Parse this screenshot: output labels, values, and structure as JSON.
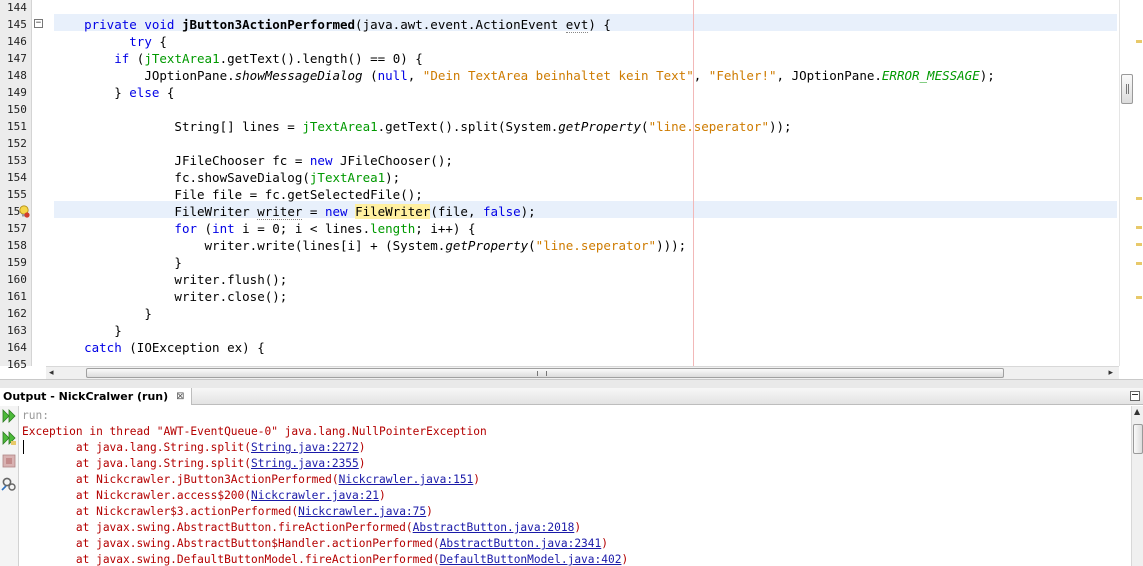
{
  "editor": {
    "line_numbers": [
      "144",
      "145",
      "146",
      "147",
      "148",
      "149",
      "150",
      "151",
      "152",
      "153",
      "154",
      "155",
      "156",
      "157",
      "158",
      "159",
      "160",
      "161",
      "162",
      "163",
      "164",
      "165"
    ],
    "lines": [
      {
        "n": 0,
        "indent": "",
        "parts": []
      },
      {
        "n": 1,
        "indent": "    ",
        "parts": [
          [
            "kw",
            "private void "
          ],
          [
            "bold",
            "jButton3ActionPerformed"
          ],
          [
            "",
            "(java.awt.event.ActionEvent "
          ],
          [
            "dotted",
            "evt"
          ],
          [
            "",
            ") {"
          ]
        ]
      },
      {
        "n": 2,
        "indent": "          ",
        "parts": [
          [
            "kw",
            "try"
          ],
          [
            "",
            " {"
          ]
        ]
      },
      {
        "n": 3,
        "indent": "        ",
        "parts": [
          [
            "kw",
            "if"
          ],
          [
            "",
            " ("
          ],
          [
            "fld",
            "jTextArea1"
          ],
          [
            "",
            ".getText().length() == 0) {"
          ]
        ]
      },
      {
        "n": 4,
        "indent": "            ",
        "parts": [
          [
            "",
            "JOptionPane."
          ],
          [
            "it",
            "showMessageDialog"
          ],
          [
            "",
            " ("
          ],
          [
            "kw",
            "null"
          ],
          [
            "",
            ", "
          ],
          [
            "str",
            "\"Dein TextArea beinhaltet kein Text\""
          ],
          [
            "",
            ", "
          ],
          [
            "str",
            "\"Fehler!\""
          ],
          [
            "",
            ", JOptionPane."
          ],
          [
            "fld it",
            "ERROR_MESSAGE"
          ],
          [
            "",
            ");"
          ]
        ]
      },
      {
        "n": 5,
        "indent": "        ",
        "parts": [
          [
            "",
            "} "
          ],
          [
            "kw",
            "else"
          ],
          [
            "",
            " {"
          ]
        ]
      },
      {
        "n": 6,
        "indent": "",
        "parts": []
      },
      {
        "n": 7,
        "indent": "                ",
        "parts": [
          [
            "",
            "String[] lines = "
          ],
          [
            "fld",
            "jTextArea1"
          ],
          [
            "",
            ".getText().split(System."
          ],
          [
            "it",
            "getProperty"
          ],
          [
            "",
            "("
          ],
          [
            "str",
            "\"line.seperator\""
          ],
          [
            "",
            "));"
          ]
        ]
      },
      {
        "n": 8,
        "indent": "",
        "parts": []
      },
      {
        "n": 9,
        "indent": "                ",
        "parts": [
          [
            "",
            "JFileChooser fc = "
          ],
          [
            "kw",
            "new"
          ],
          [
            "",
            " JFileChooser();"
          ]
        ]
      },
      {
        "n": 10,
        "indent": "                ",
        "parts": [
          [
            "",
            "fc.showSaveDialog("
          ],
          [
            "fld",
            "jTextArea1"
          ],
          [
            "",
            ");"
          ]
        ]
      },
      {
        "n": 11,
        "indent": "                ",
        "parts": [
          [
            "",
            "File file = fc.getSelectedFile();"
          ]
        ]
      },
      {
        "n": 12,
        "indent": "                ",
        "parts": [
          [
            "",
            "FileWriter "
          ],
          [
            "dotted",
            "writer"
          ],
          [
            "",
            " = "
          ],
          [
            "kw",
            "new "
          ],
          [
            "mark",
            "FileWriter"
          ],
          [
            "",
            "(file, "
          ],
          [
            "kw",
            "false"
          ],
          [
            "",
            ");"
          ]
        ]
      },
      {
        "n": 13,
        "indent": "                ",
        "parts": [
          [
            "kw",
            "for"
          ],
          [
            "",
            " ("
          ],
          [
            "kw",
            "int"
          ],
          [
            "",
            " i = 0; i < lines."
          ],
          [
            "fld",
            "length"
          ],
          [
            "",
            "; i++) {"
          ]
        ]
      },
      {
        "n": 14,
        "indent": "                    ",
        "parts": [
          [
            "",
            "writer.write(lines[i] + (System."
          ],
          [
            "it",
            "getProperty"
          ],
          [
            "",
            "("
          ],
          [
            "str",
            "\"line.seperator\""
          ],
          [
            "",
            ")));"
          ]
        ]
      },
      {
        "n": 15,
        "indent": "                ",
        "parts": [
          [
            "",
            "}"
          ]
        ]
      },
      {
        "n": 16,
        "indent": "                ",
        "parts": [
          [
            "",
            "writer.flush();"
          ]
        ]
      },
      {
        "n": 17,
        "indent": "                ",
        "parts": [
          [
            "",
            "writer.close();"
          ]
        ]
      },
      {
        "n": 18,
        "indent": "            ",
        "parts": [
          [
            "",
            "}"
          ]
        ]
      },
      {
        "n": 19,
        "indent": "        ",
        "parts": [
          [
            "",
            "}"
          ]
        ]
      },
      {
        "n": 20,
        "indent": "    ",
        "parts": [
          [
            "kw",
            "catch"
          ],
          [
            "",
            " (IOException ex) {"
          ]
        ]
      },
      {
        "n": 21,
        "indent": "",
        "parts": []
      }
    ],
    "fold_symbol": "−",
    "hscroll_left": "◂",
    "hscroll_right": "▸"
  },
  "output": {
    "tab_label": "Output - NickCralwer (run)",
    "tab_close": "⊠",
    "lines": [
      {
        "type": "run",
        "text": "run:"
      },
      {
        "type": "err",
        "text": "Exception in thread \"AWT-EventQueue-0\" java.lang.NullPointerException"
      },
      {
        "type": "trace",
        "prefix": "        at java.lang.String.split(",
        "link": "String.java:2272",
        "suffix": ")"
      },
      {
        "type": "trace",
        "prefix": "        at java.lang.String.split(",
        "link": "String.java:2355",
        "suffix": ")"
      },
      {
        "type": "trace",
        "prefix": "        at Nickcrawler.jButton3ActionPerformed(",
        "link": "Nickcrawler.java:151",
        "suffix": ")"
      },
      {
        "type": "trace",
        "prefix": "        at Nickcrawler.access$200(",
        "link": "Nickcrawler.java:21",
        "suffix": ")"
      },
      {
        "type": "trace",
        "prefix": "        at Nickcrawler$3.actionPerformed(",
        "link": "Nickcrawler.java:75",
        "suffix": ")"
      },
      {
        "type": "trace",
        "prefix": "        at javax.swing.AbstractButton.fireActionPerformed(",
        "link": "AbstractButton.java:2018",
        "suffix": ")"
      },
      {
        "type": "trace",
        "prefix": "        at javax.swing.AbstractButton$Handler.actionPerformed(",
        "link": "AbstractButton.java:2341",
        "suffix": ")"
      },
      {
        "type": "trace",
        "prefix": "        at javax.swing.DefaultButtonModel.fireActionPerformed(",
        "link": "DefaultButtonModel.java:402",
        "suffix": ")"
      }
    ],
    "toolbar": [
      "rerun-icon",
      "rerun-with-params-icon",
      "stop-icon",
      "settings-icon"
    ]
  },
  "colors": {
    "keyword": "#0000e6",
    "field": "#009900",
    "string": "#ce7b00",
    "error_text": "#b40000",
    "link": "#1a1aa8",
    "current_line": "#e8f0fb"
  }
}
